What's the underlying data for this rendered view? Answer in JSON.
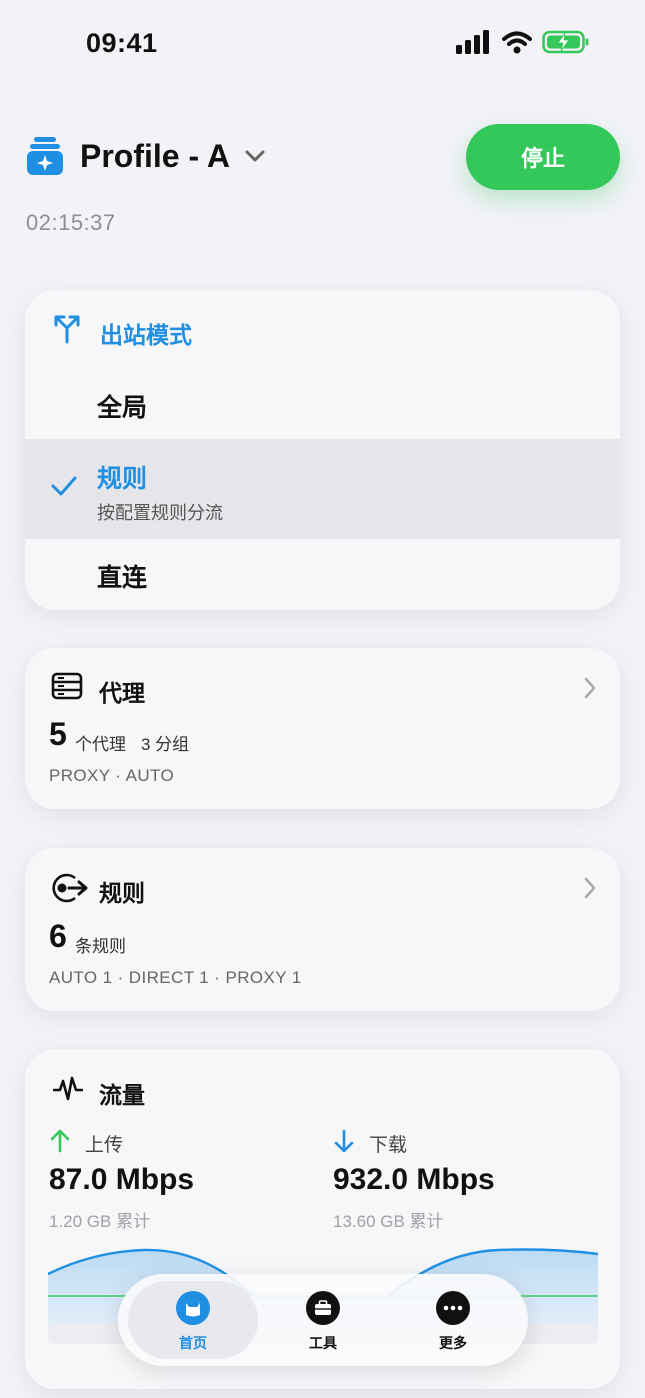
{
  "status": {
    "time": "09:41"
  },
  "header": {
    "profile_name": "Profile - A",
    "stop_label": "停止",
    "uptime": "02:15:37"
  },
  "outbound": {
    "title": "出站模式",
    "options": [
      {
        "label": "全局"
      },
      {
        "label": "规则",
        "desc": "按配置规则分流",
        "selected": true
      },
      {
        "label": "直连"
      }
    ]
  },
  "proxies": {
    "title": "代理",
    "count": "5",
    "count_unit": "个代理",
    "groups": "3 分组",
    "summary": "PROXY · AUTO"
  },
  "rules": {
    "title": "规则",
    "count": "6",
    "count_unit": "条规则",
    "summary": "AUTO 1 · DIRECT 1 · PROXY 1"
  },
  "traffic": {
    "title": "流量",
    "upload_label": "上传",
    "upload_value": "87.0 Mbps",
    "upload_total": "1.20 GB 累计",
    "download_label": "下载",
    "download_value": "932.0 Mbps",
    "download_total": "13.60 GB 累计"
  },
  "tabs": [
    {
      "label": "首页",
      "active": true
    },
    {
      "label": "工具"
    },
    {
      "label": "更多"
    }
  ],
  "colors": {
    "accent": "#1e8fe3",
    "stop": "#34c759",
    "upload": "#34c759",
    "download": "#1e8fe3"
  },
  "icons": {
    "profile": "stack-sparkle-icon",
    "outbound": "branch-arrow-icon",
    "proxies": "server-icon",
    "rules": "rule-arrow-icon",
    "traffic": "waveform-icon",
    "upload": "arrow-up-icon",
    "download": "arrow-down-icon"
  }
}
